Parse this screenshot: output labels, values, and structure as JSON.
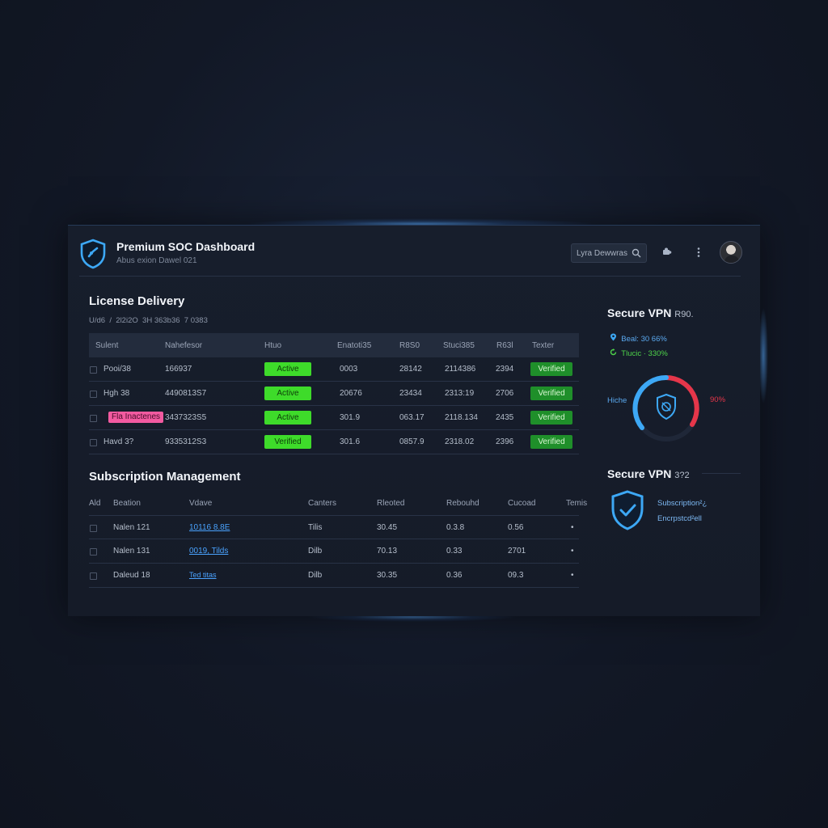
{
  "header": {
    "title": "Premium SOC Dashboard",
    "subtitle": "Abus exion Dawel 021",
    "search_value": "Lyra Dewwras"
  },
  "license": {
    "title": "License Delivery",
    "breadcrumb": [
      "U/d6",
      "/",
      "2l2i2O",
      "3H 363b36",
      "7 0383"
    ],
    "columns": [
      "Sulent",
      "Nahefesor",
      "Htuo",
      "Enatoti35",
      "R8S0",
      "Stuci385",
      "R63l",
      "Texter"
    ],
    "rows": [
      {
        "c1": "Pooi/38",
        "c2": "166937",
        "status": "Active",
        "c4": "0003",
        "c5": "28142",
        "c6": "2114386",
        "c7": "2394",
        "verify": "Verified"
      },
      {
        "c1": "Hgh 38",
        "c2": "4490813S7",
        "status": "Active",
        "c4": "20676",
        "c5": "23434",
        "c6": "2313:19",
        "c7": "2706",
        "verify": "Verified"
      },
      {
        "c1": "Fla Inactenes",
        "c2": "3437323S5",
        "status": "Active",
        "c4": "301.9",
        "c5": "063.17",
        "c6": "2118.134",
        "c7": "2435",
        "verify": "Verified"
      },
      {
        "c1": "Havd 3?",
        "c2": "9335312S3",
        "status": "Verified",
        "c4": "301.6",
        "c5": "0857.9",
        "c6": "2318.02",
        "c7": "2396",
        "verify": "Verified"
      }
    ]
  },
  "subscription": {
    "title": "Subscription Management",
    "columns": [
      "Ald",
      "Beation",
      "Vdave",
      "Canters",
      "Rleoted",
      "Rebouhd",
      "Cucoad",
      "Temis"
    ],
    "rows": [
      {
        "name": "Nalen 121",
        "link": "10116 8.8E",
        "c3": "Tilis",
        "c4": "30.45",
        "c5": "0.3.8",
        "c6": "0.56",
        "c7": "•"
      },
      {
        "name": "Nalen 131",
        "link": "0019, Tilds",
        "c3": "Dilb",
        "c4": "70.13",
        "c5": "0.33",
        "c6": "2701",
        "c7": "•"
      },
      {
        "name": "Daleud 18",
        "link": "Ted titas",
        "c3": "Dilb",
        "c4": "30.35",
        "c5": "0.36",
        "c6": "09.3",
        "c7": "•"
      }
    ]
  },
  "vpn1": {
    "title": "Secure VPN",
    "title_suffix": "R90.",
    "stat_a": "Beal: 30 66%",
    "stat_b": "Tlucic · 330%",
    "gauge_left": "Hiche",
    "gauge_right": "90%"
  },
  "vpn2": {
    "title": "Secure VPN",
    "title_suffix": "3?2",
    "line1": "Subscription²¿",
    "line2": "Encrpstcd²ell"
  },
  "colors": {
    "accent_blue": "#3da8f5",
    "accent_red": "#e5364a",
    "status_green": "#3edb2a",
    "verified_green": "#1f8f2a",
    "badge_pink": "#f25aa0"
  }
}
